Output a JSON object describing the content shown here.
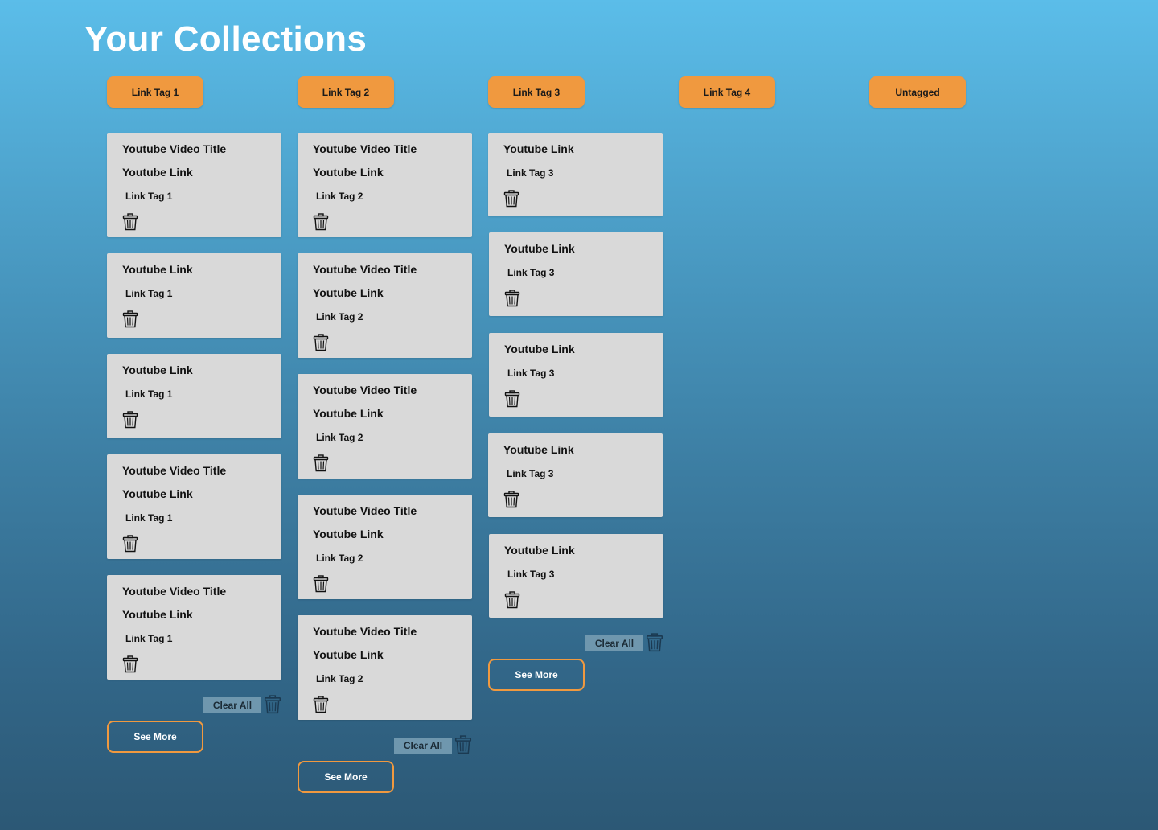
{
  "page": {
    "title": "Your Collections"
  },
  "tags": [
    "Link Tag 1",
    "Link Tag 2",
    "Link Tag 3",
    "Link Tag 4",
    "Untagged"
  ],
  "columns": [
    {
      "tag": "Link Tag 1",
      "cards": [
        {
          "title": "Youtube Video Title",
          "link": "Youtube Link",
          "tag": "Link Tag 1"
        },
        {
          "title": "",
          "link": "Youtube Link",
          "tag": "Link Tag 1"
        },
        {
          "title": "",
          "link": "Youtube Link",
          "tag": "Link Tag 1"
        },
        {
          "title": "Youtube Video Title",
          "link": "Youtube Link",
          "tag": "Link Tag 1"
        },
        {
          "title": "Youtube Video Title",
          "link": "Youtube Link",
          "tag": "Link Tag 1"
        }
      ],
      "clear_all": "Clear All",
      "see_more": "See More"
    },
    {
      "tag": "Link Tag 2",
      "cards": [
        {
          "title": "Youtube Video Title",
          "link": "Youtube Link",
          "tag": "Link Tag 2"
        },
        {
          "title": "Youtube Video Title",
          "link": "Youtube Link",
          "tag": "Link Tag 2"
        },
        {
          "title": "Youtube Video Title",
          "link": "Youtube Link",
          "tag": "Link Tag 2"
        },
        {
          "title": "Youtube Video Title",
          "link": "Youtube Link",
          "tag": "Link Tag 2"
        },
        {
          "title": "Youtube Video Title",
          "link": "Youtube Link",
          "tag": "Link Tag 2"
        }
      ],
      "clear_all": "Clear All",
      "see_more": "See More"
    },
    {
      "tag": "Link Tag 3",
      "cards": [
        {
          "title": "",
          "link": "Youtube Link",
          "tag": "Link Tag 3"
        },
        {
          "title": "",
          "link": "Youtube Link",
          "tag": "Link Tag 3"
        },
        {
          "title": "",
          "link": "Youtube Link",
          "tag": "Link Tag 3"
        },
        {
          "title": "",
          "link": "Youtube Link",
          "tag": "Link Tag 3"
        },
        {
          "title": "",
          "link": "Youtube Link",
          "tag": "Link Tag 3"
        }
      ],
      "clear_all": "Clear All",
      "see_more": "See More"
    }
  ],
  "colors": {
    "accent": "#f0993f",
    "card": "#d9d9d9",
    "clear_all_bg": "#6f97ae",
    "title": "#ffffff"
  },
  "icons": {
    "delete": "trash-icon"
  }
}
